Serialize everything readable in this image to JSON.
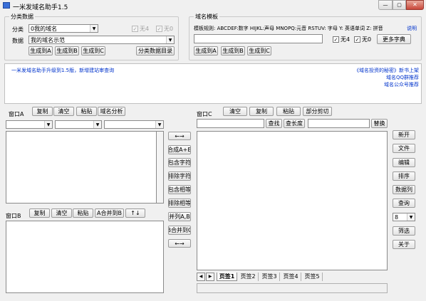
{
  "window": {
    "title": "一米发域名助手1.5",
    "controls": [
      "—",
      "▢",
      "✕"
    ]
  },
  "category": {
    "group_title": "分类数据",
    "category_label": "分类",
    "category_value": "0我的域名",
    "data_label": "数据",
    "data_value": "我的域名示范",
    "chk_none4": "无4",
    "chk_none0": "无0",
    "gen_a": "生成到A",
    "gen_b": "生成到B",
    "gen_c": "生成到C",
    "dir_button": "分类数据目录"
  },
  "template": {
    "group_title": "域名模板",
    "rule_text": "模板规则: ABCDEF:数字 HIJKL:声母 MNOPQ:元音 RSTUV: 字母 Y: 英语单词 Z: 拼音",
    "help": "说明",
    "chk_none4": "无4",
    "chk_none0": "无0",
    "more_dict": "更多字典",
    "gen_a": "生成到A",
    "gen_b": "生成到B",
    "gen_c": "生成到C"
  },
  "info": {
    "news": "一米发域名助手升级到1.5版，新增建站审查询",
    "book": "《域名投资的秘密》新书上架",
    "qq": "域名QQ群推荐",
    "wechat": "域名公众号推荐"
  },
  "win_a": {
    "label": "窗口A",
    "copy": "复制",
    "clear": "清空",
    "paste": "粘贴",
    "analyze": "域名分析"
  },
  "win_b": {
    "label": "窗口B",
    "copy": "复制",
    "clear": "清空",
    "paste": "粘贴",
    "merge": "A合并到B",
    "sort": "↑↓"
  },
  "middle": {
    "swap_top": "←→",
    "merge_ab": "合成A+B",
    "contain_chars": "包含字符",
    "exclude_chars": "排除字符",
    "contain_same": "包含相等",
    "exclude_same": "排除相等",
    "parallel": "并列A,B",
    "merge_bc": "B合并到C",
    "swap_bottom": "←→"
  },
  "win_c": {
    "label": "窗口C",
    "clear": "清空",
    "copy": "复制",
    "paste": "粘贴",
    "cut": "部分剪切",
    "find": "查找",
    "find_len": "查长度",
    "replace": "替换",
    "tabs": [
      "页签1",
      "页签2",
      "页签3",
      "页签4",
      "页签5"
    ]
  },
  "right": {
    "new": "新开",
    "file": "文件",
    "edit": "编辑",
    "sort": "排序",
    "data_col": "数据列",
    "query": "查询",
    "col_value": "8",
    "filter": "筛选",
    "close": "关于"
  }
}
